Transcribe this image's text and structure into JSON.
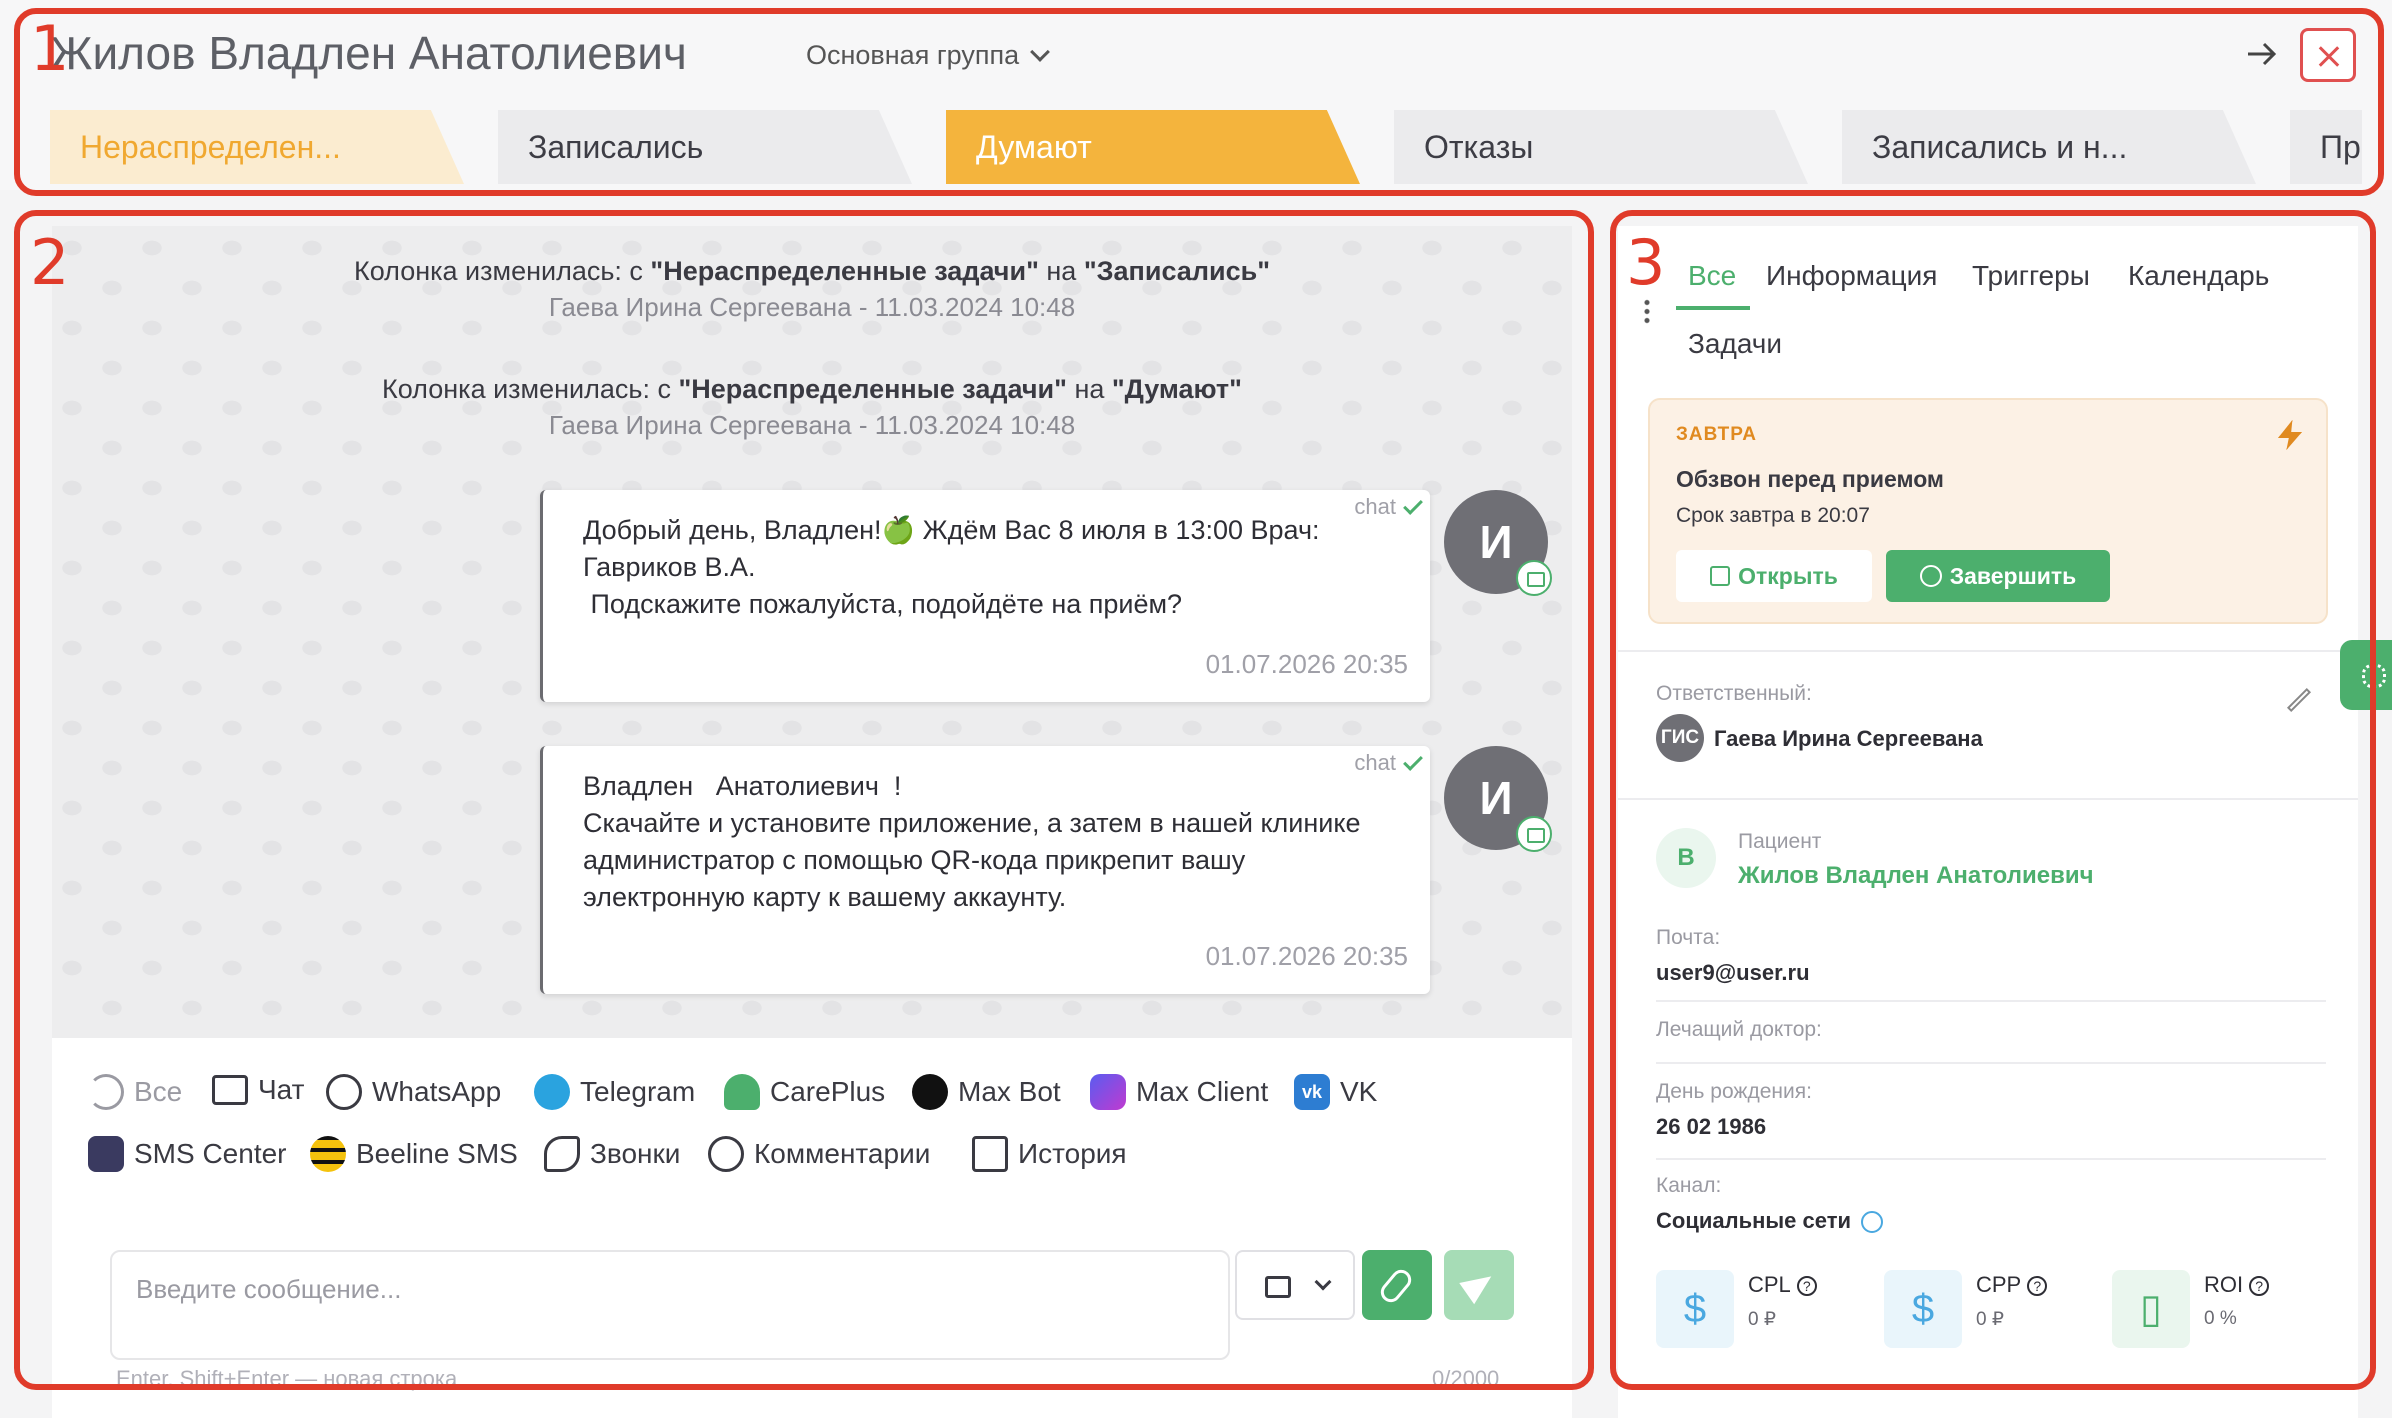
{
  "header": {
    "client_name": "Жилов Владлен Анатолиевич",
    "group": "Основная группа",
    "stages": [
      "Нераспределен...",
      "Записались",
      "Думают",
      "Отказы",
      "Записались и н...",
      "Пр"
    ],
    "active_stage": "Думают"
  },
  "annotations": [
    "1",
    "2",
    "3"
  ],
  "chat": {
    "system_messages": [
      {
        "prefix": "Колонка изменилась: с ",
        "from": "\"Нераспределенные задачи\"",
        "mid": " на ",
        "to": "\"Записались\"",
        "author": "Гаева Ирина Сергеевана - 11.03.2024 10:48"
      },
      {
        "prefix": "Колонка изменилась: с ",
        "from": "\"Нераспределенные задачи\"",
        "mid": " на ",
        "to": "\"Думают\"",
        "author": "Гаева Ирина Сергеевана - 11.03.2024 10:48"
      }
    ],
    "messages": [
      {
        "channel": "chat",
        "text": "Добрый день, Владлен!🍏 Ждём Вас 8 июля в 13:00 Врач: Гавриков В.А.\n Подскажите пожалуйста, подойдёте на приём?",
        "time": "01.07.2026 20:35",
        "avatar": "И"
      },
      {
        "channel": "chat",
        "text": "Владлен   Анатолиевич  !\nСкачайте и установите приложение, а затем в нашей клинике администратор с помощью QR-кода прикрепит вашу электронную карту к вашему аккаунту.",
        "time": "01.07.2026 20:35",
        "avatar": "И"
      }
    ],
    "channels_row1": [
      "Все",
      "Чат",
      "WhatsApp",
      "Telegram",
      "CarePlus",
      "Max Bot",
      "Max Client",
      "VK"
    ],
    "channels_row2": [
      "SMS Center",
      "Beeline SMS",
      "Звонки",
      "Комментарии",
      "История"
    ],
    "input_placeholder": "Введите сообщение...",
    "input_hint": "Enter, Shift+Enter — новая строка",
    "counter": "0/2000"
  },
  "sidebar": {
    "tabs": [
      "Все",
      "Информация",
      "Триггеры",
      "Календарь",
      "Задачи"
    ],
    "task": {
      "when": "ЗАВТРА",
      "title": "Обзвон перед приемом",
      "due": "Срок завтра в 20:07",
      "open_label": "Открыть",
      "done_label": "Завершить"
    },
    "responsible_label": "Ответственный:",
    "responsible_initials": "ГИС",
    "responsible_name": "Гаева Ирина Сергеевана",
    "patient_initial": "В",
    "patient_label": "Пациент",
    "patient_name": "Жилов Владлен Анатолиевич",
    "email_label": "Почта:",
    "email": "user9@user.ru",
    "doctor_label": "Лечащий доктор:",
    "birthday_label": "День рождения:",
    "birthday": "26 02 1986",
    "channel_label": "Канал:",
    "channel": "Социальные сети",
    "metrics": [
      {
        "name": "CPL",
        "value": "0 ₽",
        "icon": "$"
      },
      {
        "name": "CPP",
        "value": "0 ₽",
        "icon": "$"
      },
      {
        "name": "ROI",
        "value": "0 %",
        "icon": "clipboard"
      }
    ]
  },
  "colors": {
    "accent": "#4caf6d",
    "active_stage": "#f4b43d",
    "annotation": "#e03b2a"
  }
}
